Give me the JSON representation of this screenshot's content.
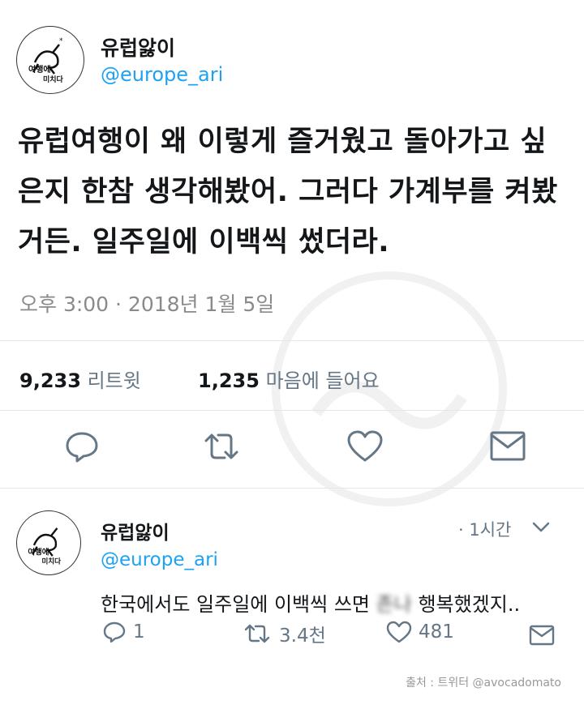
{
  "tweet": {
    "user": {
      "name": "유럽앓이",
      "handle": "@europe_ari",
      "avatar_text": [
        "여행에",
        "미치다"
      ]
    },
    "text": "유럽여행이 왜 이렇게 즐거웠고 돌아가고 싶은지 한참 생각해봤어. 그러다 가계부를 켜봤거든. 일주일에 이백씩 썼더라.",
    "timestamp": "오후 3:00 · 2018년 1월 5일",
    "stats": {
      "retweets_count": "9,233",
      "retweets_label": "리트윗",
      "likes_count": "1,235",
      "likes_label": "마음에 들어요"
    },
    "icons": [
      "reply-icon",
      "retweet-icon",
      "heart-icon",
      "message-icon"
    ]
  },
  "reply": {
    "user": {
      "name": "유럽앓이",
      "handle": "@europe_ari"
    },
    "time": "· 1시간",
    "text_before": "한국에서도 일주일에 이백씩 쓰면 ",
    "text_blurred": "존나",
    "text_after": " 행복했겠지..",
    "replies": "1",
    "retweets": "3.4천",
    "likes": "481"
  },
  "source": "출처 : 트위터 @avocadomato",
  "colors": {
    "accent": "#1da1f2",
    "text": "#14171a",
    "muted": "#657786"
  }
}
